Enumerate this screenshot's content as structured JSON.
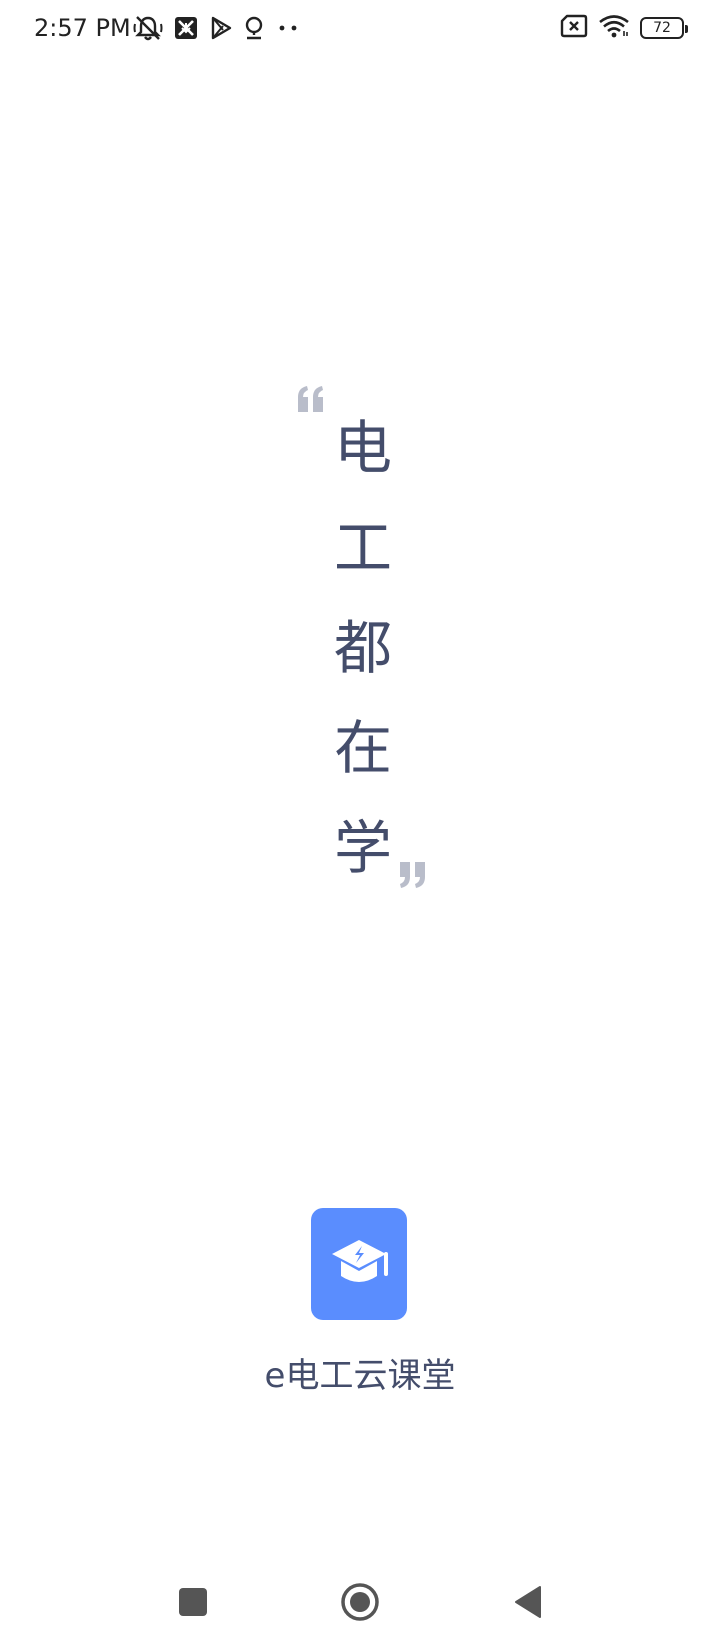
{
  "status_bar": {
    "time": "2:57 PM",
    "battery": "72",
    "left_icons": [
      "mute-icon",
      "app-notification-icon",
      "play-store-icon",
      "location-icon",
      "more-dots-icon"
    ],
    "right_icons": [
      "no-sim-icon",
      "wifi-icon",
      "battery-icon"
    ]
  },
  "splash": {
    "slogan_chars": [
      "电",
      "工",
      "都",
      "在",
      "学"
    ],
    "app_name": "e电工云课堂"
  },
  "colors": {
    "text": "#444d6b",
    "quote": "#b9bdca",
    "logo_bg": "#5a8dfe"
  },
  "nav_bar": {
    "buttons": [
      "recents-button",
      "home-button",
      "back-button"
    ]
  }
}
